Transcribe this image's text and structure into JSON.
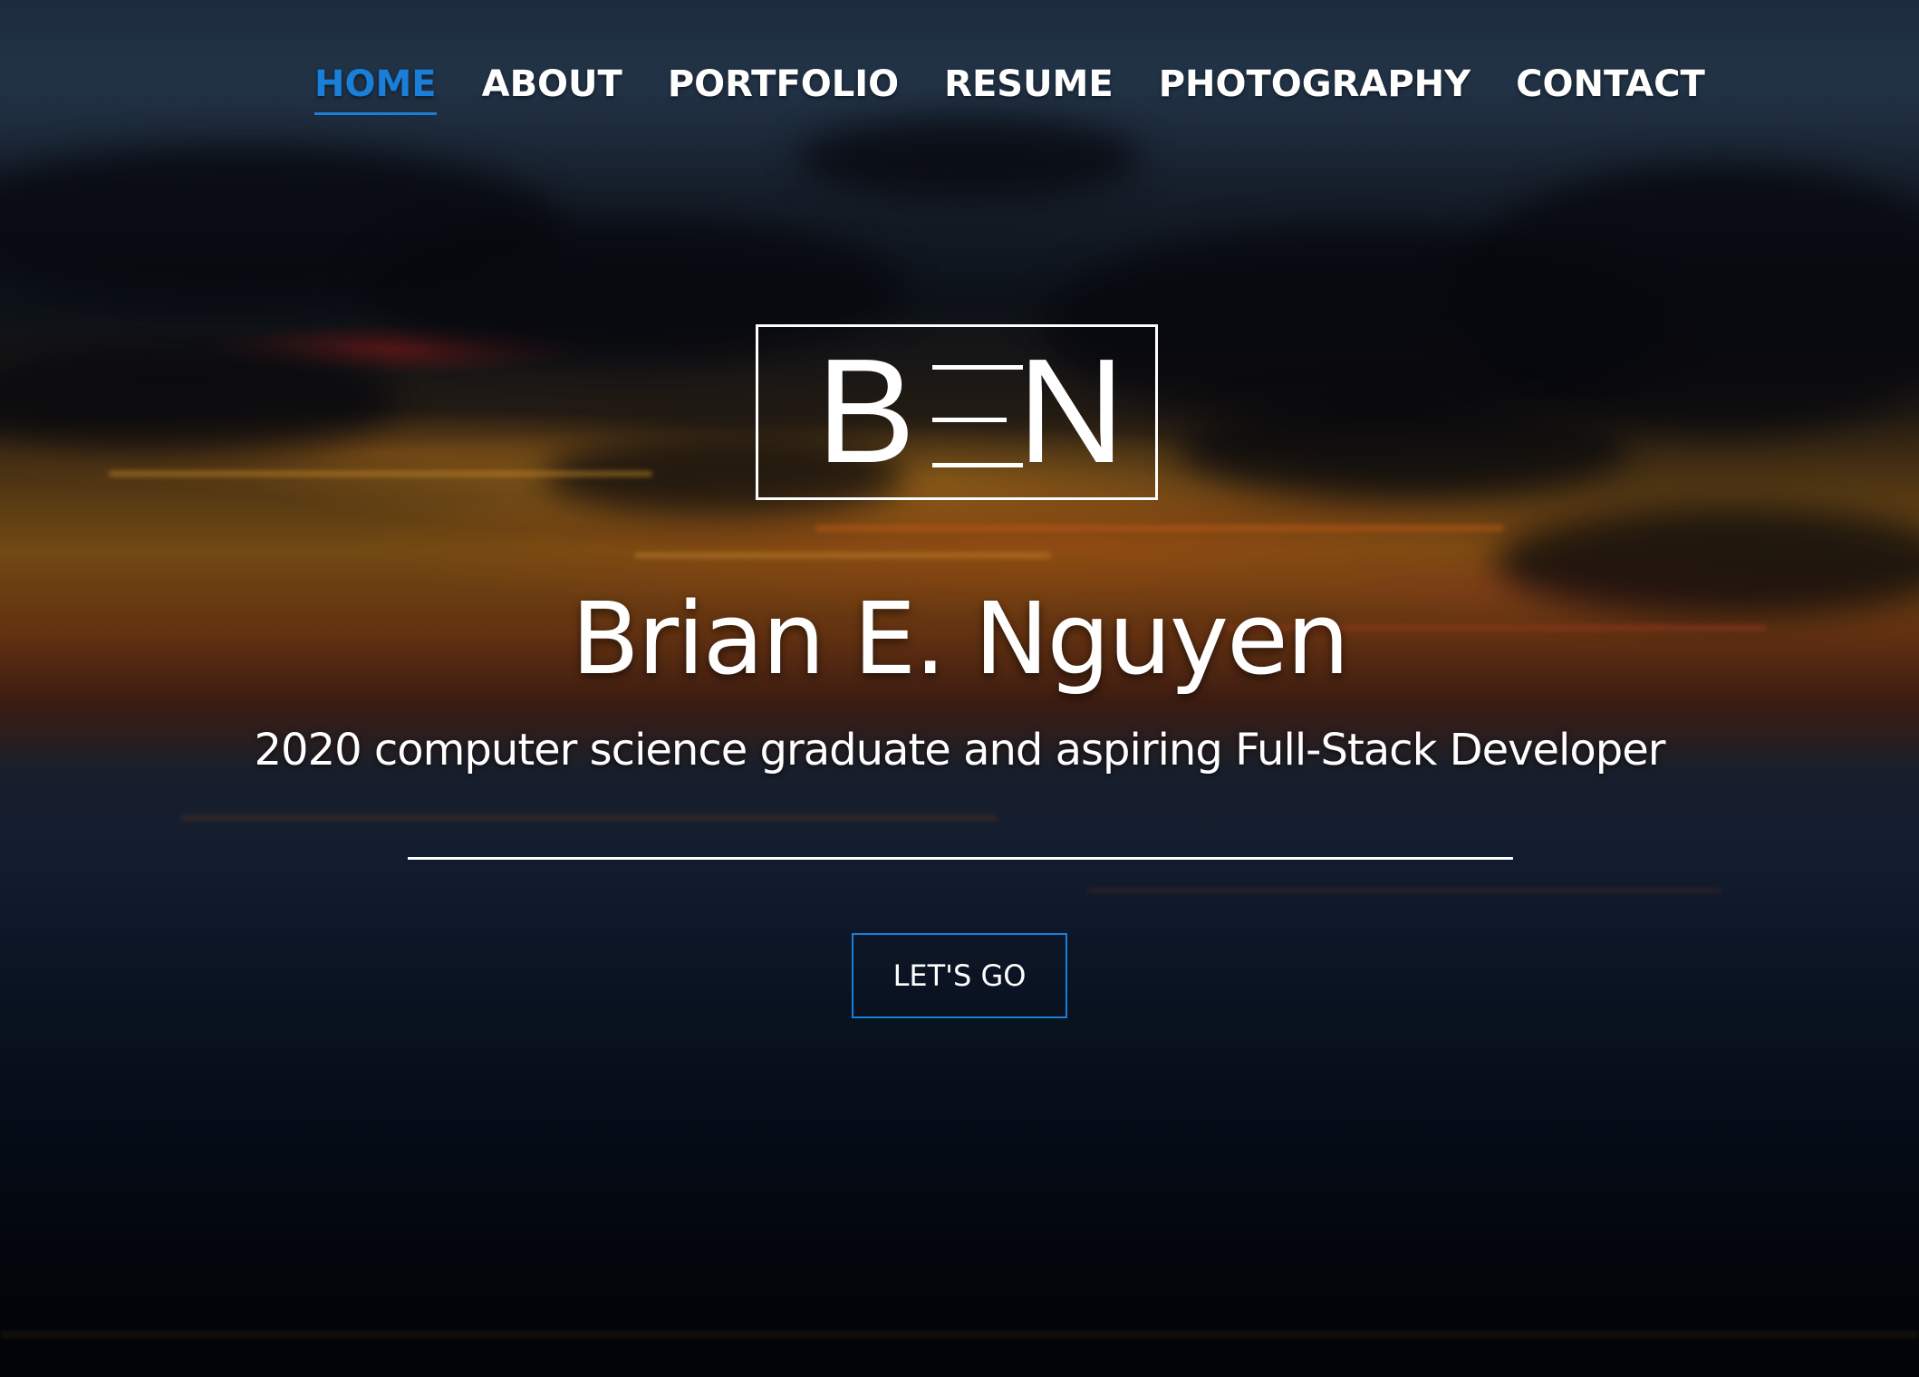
{
  "nav": {
    "items": [
      {
        "label": "HOME",
        "active": true
      },
      {
        "label": "ABOUT",
        "active": false
      },
      {
        "label": "PORTFOLIO",
        "active": false
      },
      {
        "label": "RESUME",
        "active": false
      },
      {
        "label": "PHOTOGRAPHY",
        "active": false
      },
      {
        "label": "CONTACT",
        "active": false
      }
    ],
    "active_color": "#1a7fd8",
    "text_color": "#ffffff"
  },
  "hero": {
    "logo_text": "BEN",
    "name": "Brian E. Nguyen",
    "tagline": "2020 computer science graduate and aspiring Full-Stack Developer",
    "cta_label": "LET'S GO",
    "cta_border_color": "#1a7fd8"
  }
}
